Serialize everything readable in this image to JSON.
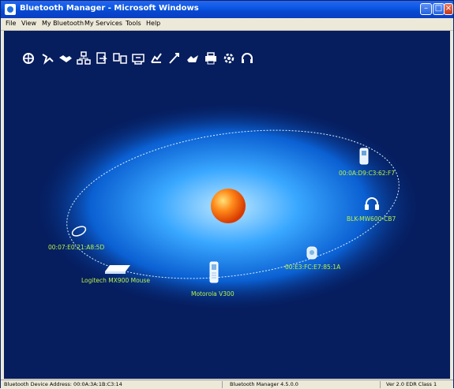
{
  "window": {
    "title": "Bluetooth Manager - Microsoft Windows"
  },
  "menu": [
    {
      "label": "File"
    },
    {
      "label": "View"
    },
    {
      "label": "My Bluetooth"
    },
    {
      "label": "My Services"
    },
    {
      "label": "Tools"
    },
    {
      "label": "Help"
    }
  ],
  "toolbar": [
    {
      "icon": "device-search-icon"
    },
    {
      "icon": "hand-pair-icon"
    },
    {
      "icon": "handshake-icon"
    },
    {
      "icon": "network-icon"
    },
    {
      "icon": "file-transfer-icon"
    },
    {
      "icon": "sync-icon"
    },
    {
      "icon": "fax-icon"
    },
    {
      "icon": "dialup-icon"
    },
    {
      "icon": "serial-port-icon"
    },
    {
      "icon": "hid-icon"
    },
    {
      "icon": "printer-icon"
    },
    {
      "icon": "settings-icon"
    },
    {
      "icon": "headset-icon"
    }
  ],
  "devices": [
    {
      "label": "00:0A:D9:C3:62:F7",
      "icon": "mobile-phone-icon"
    },
    {
      "label": "BLK-MW600-CB7",
      "icon": "headphones-icon"
    },
    {
      "label": "00:E3:FC:E7:85:1A",
      "icon": "wireless-device-icon"
    },
    {
      "label": "Motorola V300",
      "icon": "flip-phone-icon"
    },
    {
      "label": "Logitech MX900 Mouse",
      "icon": "keyboard-icon"
    },
    {
      "label": "00:07:E0:21:A8:5D",
      "icon": "mouse-icon"
    }
  ],
  "status": {
    "left": "Bluetooth Device Address: 00:0A:3A:1B:C3:14",
    "middle": "Bluetooth Manager 4.5.0.0",
    "right": "Ver 2.0 EDR Class 1"
  },
  "colors": {
    "background": "#061d5e",
    "halo": "#3aa8ff",
    "label": "#b7f046",
    "orbit": "#d9f0ff",
    "core": "#ff7a10"
  }
}
